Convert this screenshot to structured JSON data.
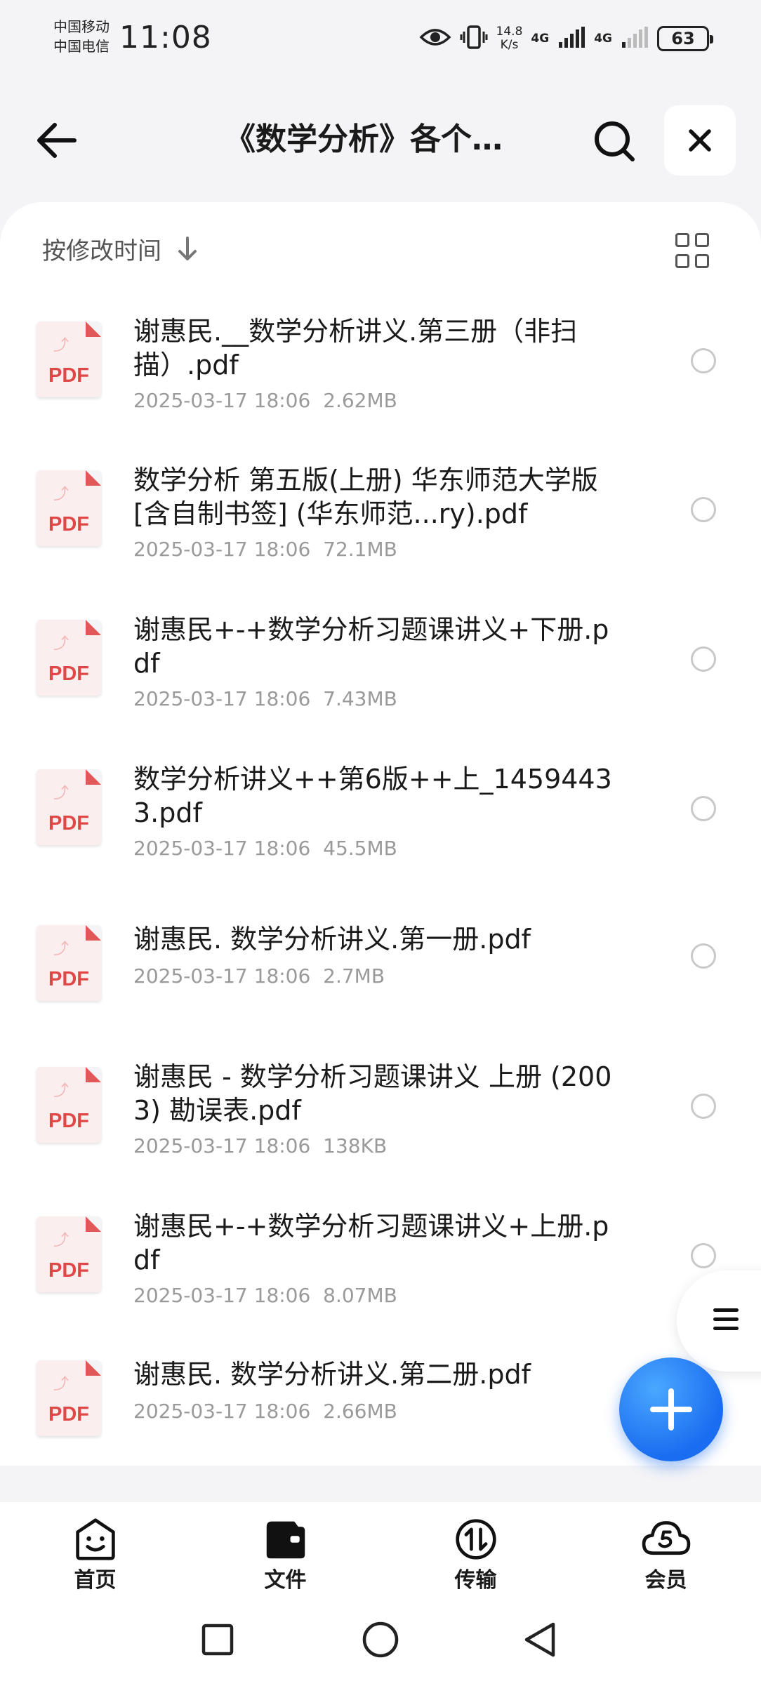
{
  "status_bar": {
    "carrier_1": "中国移动",
    "carrier_2": "中国电信",
    "time": "11:08",
    "speed_value": "14.8",
    "speed_unit": "K/s",
    "net_1": "4G",
    "net_2": "4G",
    "battery": "63"
  },
  "header": {
    "title": "《数学分析》各个…"
  },
  "toolbar": {
    "sort_label": "按修改时间"
  },
  "files": [
    {
      "name": "谢惠民.__数学分析讲义.第三册（非扫描）.pdf",
      "date": "2025-03-17 18:06",
      "size": "2.62MB",
      "type_label": "PDF"
    },
    {
      "name": "数学分析 第五版(上册) 华东师范大学版 [含自制书签] (华东师范...ry).pdf",
      "date": "2025-03-17 18:06",
      "size": "72.1MB",
      "type_label": "PDF"
    },
    {
      "name": "谢惠民+-+数学分析习题课讲义+下册.pdf",
      "date": "2025-03-17 18:06",
      "size": "7.43MB",
      "type_label": "PDF"
    },
    {
      "name": "数学分析讲义++第6版++上_14594433.pdf",
      "date": "2025-03-17 18:06",
      "size": "45.5MB",
      "type_label": "PDF"
    },
    {
      "name": "谢惠民. 数学分析讲义.第一册.pdf",
      "date": "2025-03-17 18:06",
      "size": "2.7MB",
      "type_label": "PDF"
    },
    {
      "name": "谢惠民 - 数学分析习题课讲义 上册 (2003) 勘误表.pdf",
      "date": "2025-03-17 18:06",
      "size": "138KB",
      "type_label": "PDF"
    },
    {
      "name": "谢惠民+-+数学分析习题课讲义+上册.pdf",
      "date": "2025-03-17 18:06",
      "size": "8.07MB",
      "type_label": "PDF"
    },
    {
      "name": "谢惠民. 数学分析讲义.第二册.pdf",
      "date": "2025-03-17 18:06",
      "size": "2.66MB",
      "type_label": "PDF"
    }
  ],
  "bottom_nav": {
    "home": "首页",
    "files": "文件",
    "transfer": "传输",
    "vip": "会员"
  }
}
